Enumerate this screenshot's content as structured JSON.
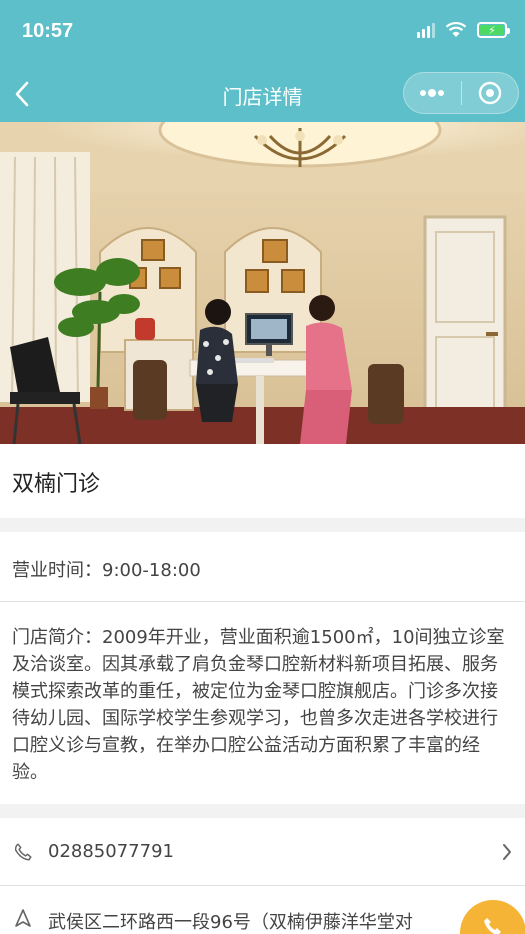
{
  "status_bar": {
    "time": "10:57"
  },
  "nav": {
    "title": "门店详情"
  },
  "store": {
    "name": "双楠门诊",
    "hours": "营业时间：9:00-18:00",
    "intro": "门店简介：2009年开业，营业面积逾1500㎡，10间独立诊室及洽谈室。因其承载了肩负金琴口腔新材料新项目拓展、服务模式探索改革的重任，被定位为金琴口腔旗舰店。门诊多次接待幼儿园、国际学校学生参观学习，也曾多次走进各学校进行口腔义诊与宣教，在举办口腔公益活动方面积累了丰富的经验。",
    "phone": "02885077791",
    "address": "武侯区二环路西一段96号（双楠伊藤洋华堂对"
  },
  "colors": {
    "header": "#5dbfc9",
    "fab": "#f5b435",
    "battery": "#4cd964"
  },
  "icons": [
    "back-icon",
    "more-icon",
    "close-mini-program-icon",
    "phone-icon",
    "chevron-right-icon",
    "location-icon",
    "fab-icon"
  ]
}
